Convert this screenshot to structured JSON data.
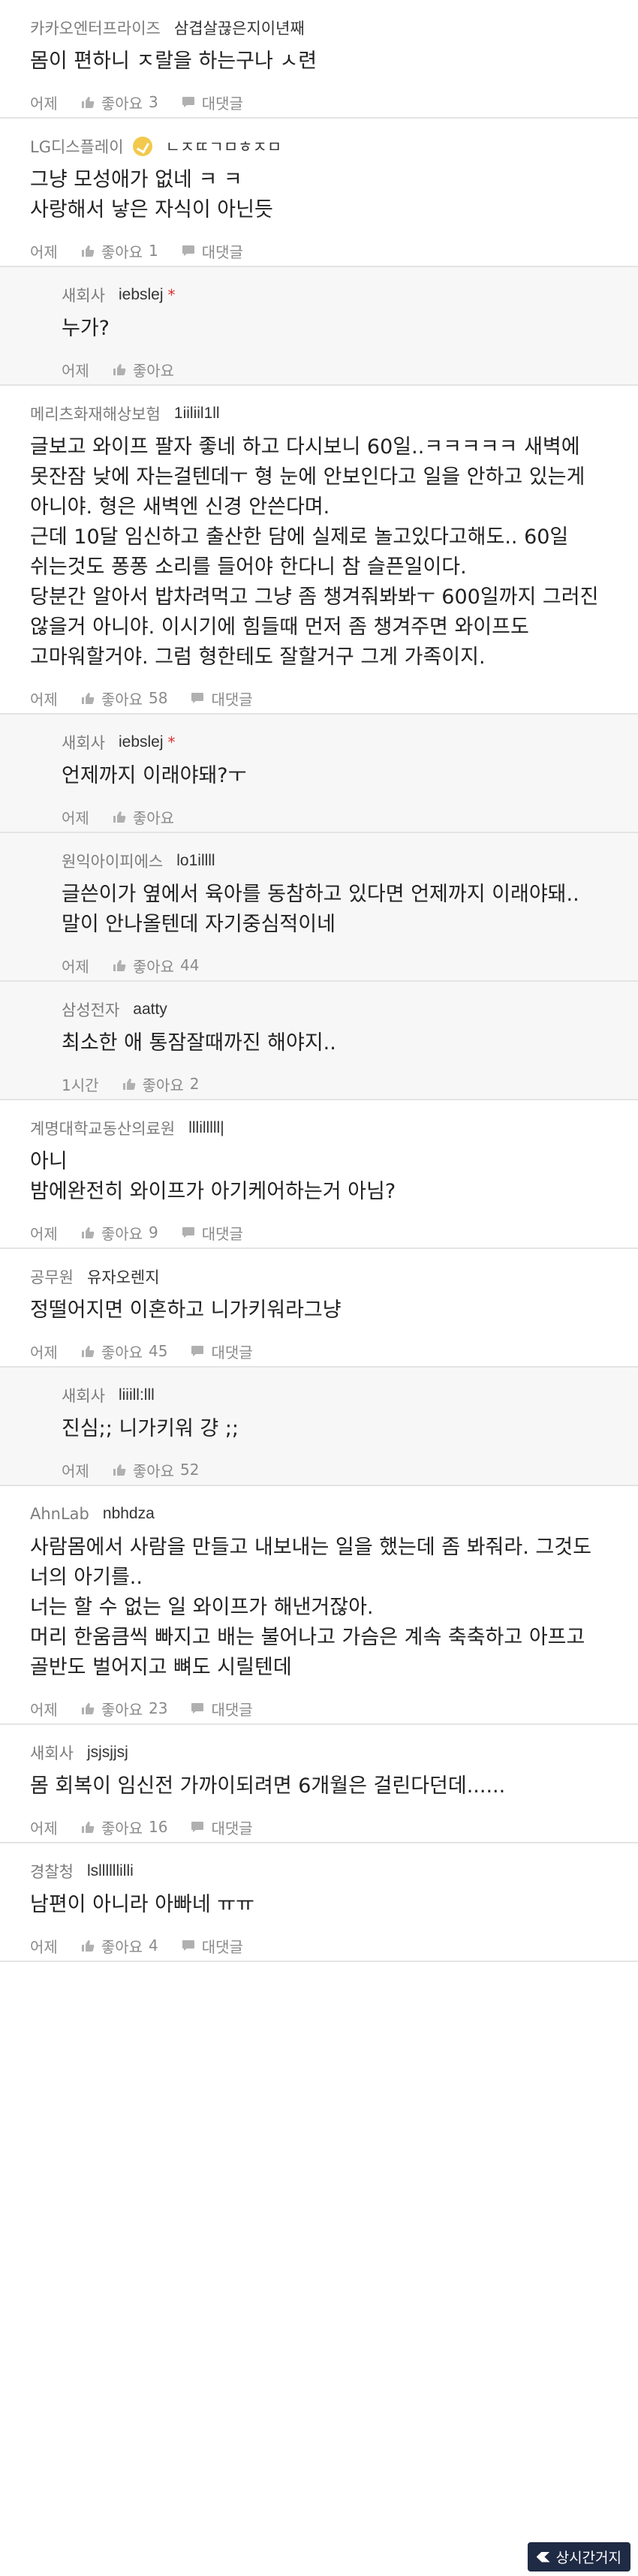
{
  "actions": {
    "like_label": "좋아요",
    "reply_label": "대댓글"
  },
  "colors": {
    "accent_mark": "#e03030",
    "badge": "#f2c94c",
    "reply_background": "#f7f7f7"
  },
  "comments": [
    {
      "company": "카카오엔터프라이즈",
      "nick": "삼겹살끊은지이년째",
      "badge": false,
      "author_mark": "",
      "text": "몸이 편하니 ㅈ랄을 하는구나 ㅅ련",
      "time": "어제",
      "likes": "3",
      "has_reply": true,
      "is_reply": false
    },
    {
      "company": "LG디스플레이",
      "nick": "ㄴㅈㄸㄱㅁㅎㅈㅁ",
      "badge": true,
      "author_mark": "",
      "text": "그냥 모성애가 없네 ㅋ ㅋ\n사랑해서 낳은 자식이 아닌듯",
      "time": "어제",
      "likes": "1",
      "has_reply": true,
      "is_reply": false
    },
    {
      "company": "새회사",
      "nick": "iebslej",
      "badge": false,
      "author_mark": "*",
      "text": "누가?",
      "time": "어제",
      "likes": "",
      "has_reply": false,
      "is_reply": true
    },
    {
      "company": "메리츠화재해상보험",
      "nick": "1iiliil1ll",
      "badge": false,
      "author_mark": "",
      "text": "글보고 와이프 팔자 좋네 하고 다시보니 60일..ㅋㅋㅋㅋㅋ 새벽에 못잔잠 낮에 자는걸텐데ㅜ 형 눈에 안보인다고 일을 안하고 있는게 아니야. 형은 새벽엔 신경 안쓴다며.\n근데 10달 임신하고 출산한 담에 실제로 놀고있다고해도.. 60일 쉬는것도 퐁퐁 소리를 들어야 한다니 참 슬픈일이다.\n당분간 알아서 밥차려먹고 그냥 좀 챙겨줘봐봐ㅜ 600일까지 그러진 않을거 아니야. 이시기에 힘들때 먼저 좀 챙겨주면 와이프도 고마워할거야. 그럼 형한테도 잘할거구 그게 가족이지.",
      "time": "어제",
      "likes": "58",
      "has_reply": true,
      "is_reply": false
    },
    {
      "company": "새회사",
      "nick": "iebslej",
      "badge": false,
      "author_mark": "*",
      "text": "언제까지 이래야돼?ㅜ",
      "time": "어제",
      "likes": "",
      "has_reply": false,
      "is_reply": true
    },
    {
      "company": "원익아이피에스",
      "nick": "lo1illll",
      "badge": false,
      "author_mark": "",
      "text": "글쓴이가 옆에서 육아를 동참하고 있다면 언제까지 이래야돼.. 말이 안나올텐데 자기중심적이네",
      "time": "어제",
      "likes": "44",
      "has_reply": false,
      "is_reply": true
    },
    {
      "company": "삼성전자",
      "nick": "aatty",
      "badge": false,
      "author_mark": "",
      "text": "최소한 애 통잠잘때까진 해야지..",
      "time": "1시간",
      "likes": "2",
      "has_reply": false,
      "is_reply": true
    },
    {
      "company": "계명대학교동산의료원",
      "nick": "lllilllll|",
      "badge": false,
      "author_mark": "",
      "text": "아니\n밤에완전히 와이프가 아기케어하는거 아님?",
      "time": "어제",
      "likes": "9",
      "has_reply": true,
      "is_reply": false
    },
    {
      "company": "공무원",
      "nick": "유자오렌지",
      "badge": false,
      "author_mark": "",
      "text": "정떨어지면 이혼하고 니가키워라그냥",
      "time": "어제",
      "likes": "45",
      "has_reply": true,
      "is_reply": false
    },
    {
      "company": "새회사",
      "nick": "liiill:lll",
      "badge": false,
      "author_mark": "",
      "text": "진심;; 니가키워 걍 ;;",
      "time": "어제",
      "likes": "52",
      "has_reply": false,
      "is_reply": true
    },
    {
      "company": "AhnLab",
      "nick": "nbhdza",
      "badge": false,
      "author_mark": "",
      "text": "사람몸에서 사람을 만들고 내보내는 일을 했는데 좀 봐줘라. 그것도 너의 아기를..\n너는 할 수 없는 일 와이프가 해낸거잖아.\n머리 한움큼씩 빠지고 배는 불어나고 가슴은 계속 축축하고 아프고 골반도 벌어지고 뼈도 시릴텐데",
      "time": "어제",
      "likes": "23",
      "has_reply": true,
      "is_reply": false
    },
    {
      "company": "새회사",
      "nick": "jsjsjjsj",
      "badge": false,
      "author_mark": "",
      "text": "몸 회복이 임신전 가까이되려면 6개월은 걸린다던데......",
      "time": "어제",
      "likes": "16",
      "has_reply": true,
      "is_reply": false
    },
    {
      "company": "경찰청",
      "nick": "lsllllllilli",
      "badge": false,
      "author_mark": "",
      "text": "남편이 아니라 아빠네 ㅠㅠ",
      "time": "어제",
      "likes": "4",
      "has_reply": true,
      "is_reply": false
    }
  ],
  "watermark": {
    "text": "상시간거지"
  }
}
